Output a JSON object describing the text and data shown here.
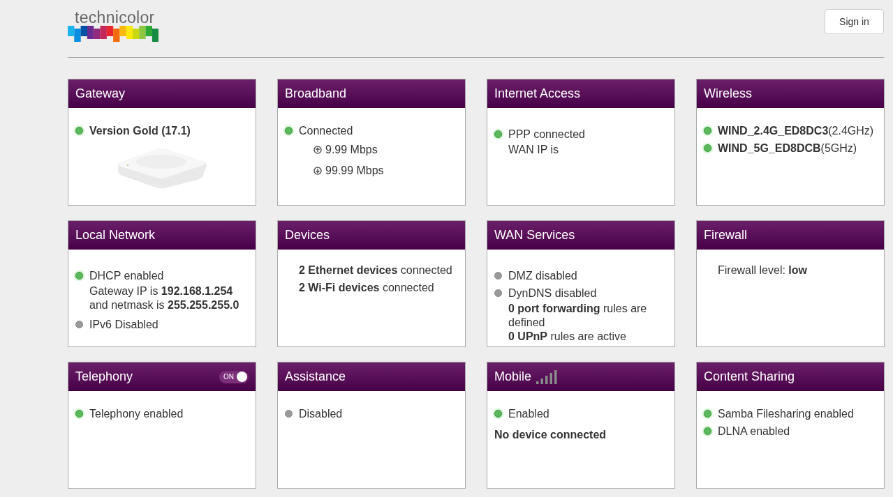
{
  "logo": {
    "text": "technicolor"
  },
  "sign_in": "Sign in",
  "cards": [
    {
      "title": "Gateway",
      "lines": [
        {
          "kind": "status",
          "on": true,
          "bold": true,
          "text": "Version Gold (17.1)"
        },
        {
          "kind": "device_image"
        }
      ]
    },
    {
      "title": "Broadband",
      "lines": [
        {
          "kind": "status",
          "on": true,
          "text": "Connected"
        },
        {
          "kind": "upload",
          "text": "9.99 Mbps"
        },
        {
          "kind": "download",
          "text": "99.99 Mbps"
        }
      ]
    },
    {
      "title": "Internet Access",
      "lines": [
        {
          "kind": "spacer"
        },
        {
          "kind": "status",
          "on": true,
          "text": "PPP connected"
        },
        {
          "kind": "text",
          "text": "WAN IP is"
        }
      ]
    },
    {
      "title": "Wireless",
      "lines": [
        {
          "kind": "status",
          "on": true,
          "text": "**WIND_2.4G_ED8DC3**(2.4GHz)"
        },
        {
          "kind": "status",
          "on": true,
          "text": "**WIND_5G_ED8DCB**(5GHz)"
        }
      ]
    },
    {
      "title": "Local Network",
      "lines": [
        {
          "kind": "spacer"
        },
        {
          "kind": "status",
          "on": true,
          "text": "DHCP enabled"
        },
        {
          "kind": "text",
          "text": "Gateway IP is **192.168.1.254**"
        },
        {
          "kind": "text",
          "text": "and netmask is **255.255.255.0**"
        },
        {
          "kind": "spacer"
        },
        {
          "kind": "status",
          "on": false,
          "text": "IPv6 Disabled"
        }
      ]
    },
    {
      "title": "Devices",
      "lines": [
        {
          "kind": "text",
          "text": "**2 Ethernet devices** connected"
        },
        {
          "kind": "spacer"
        },
        {
          "kind": "text",
          "text": "**2 Wi-Fi devices** connected"
        }
      ]
    },
    {
      "title": "WAN Services",
      "lines": [
        {
          "kind": "spacer"
        },
        {
          "kind": "status",
          "on": false,
          "text": "DMZ disabled"
        },
        {
          "kind": "status",
          "on": false,
          "text": "DynDNS disabled"
        },
        {
          "kind": "text",
          "text": "**0 port forwarding** rules are defined"
        },
        {
          "kind": "text",
          "text": "**0 UPnP** rules are active"
        }
      ]
    },
    {
      "title": "Firewall",
      "lines": [
        {
          "kind": "text",
          "text": "Firewall level: **low**"
        }
      ]
    },
    {
      "title": "Telephony",
      "toggle": {
        "label": "ON",
        "on": true
      },
      "lines": [
        {
          "kind": "status",
          "on": true,
          "text": "Telephony enabled"
        }
      ]
    },
    {
      "title": "Assistance",
      "lines": [
        {
          "kind": "status",
          "on": false,
          "text": "Disabled"
        }
      ]
    },
    {
      "title": "Mobile",
      "signal": true,
      "lines": [
        {
          "kind": "status",
          "on": true,
          "text": "Enabled"
        },
        {
          "kind": "note",
          "text": "No device connected"
        }
      ]
    },
    {
      "title": "Content Sharing",
      "lines": [
        {
          "kind": "status",
          "on": true,
          "text": "Samba Filesharing enabled"
        },
        {
          "kind": "status",
          "on": true,
          "text": "DLNA enabled"
        }
      ]
    }
  ]
}
